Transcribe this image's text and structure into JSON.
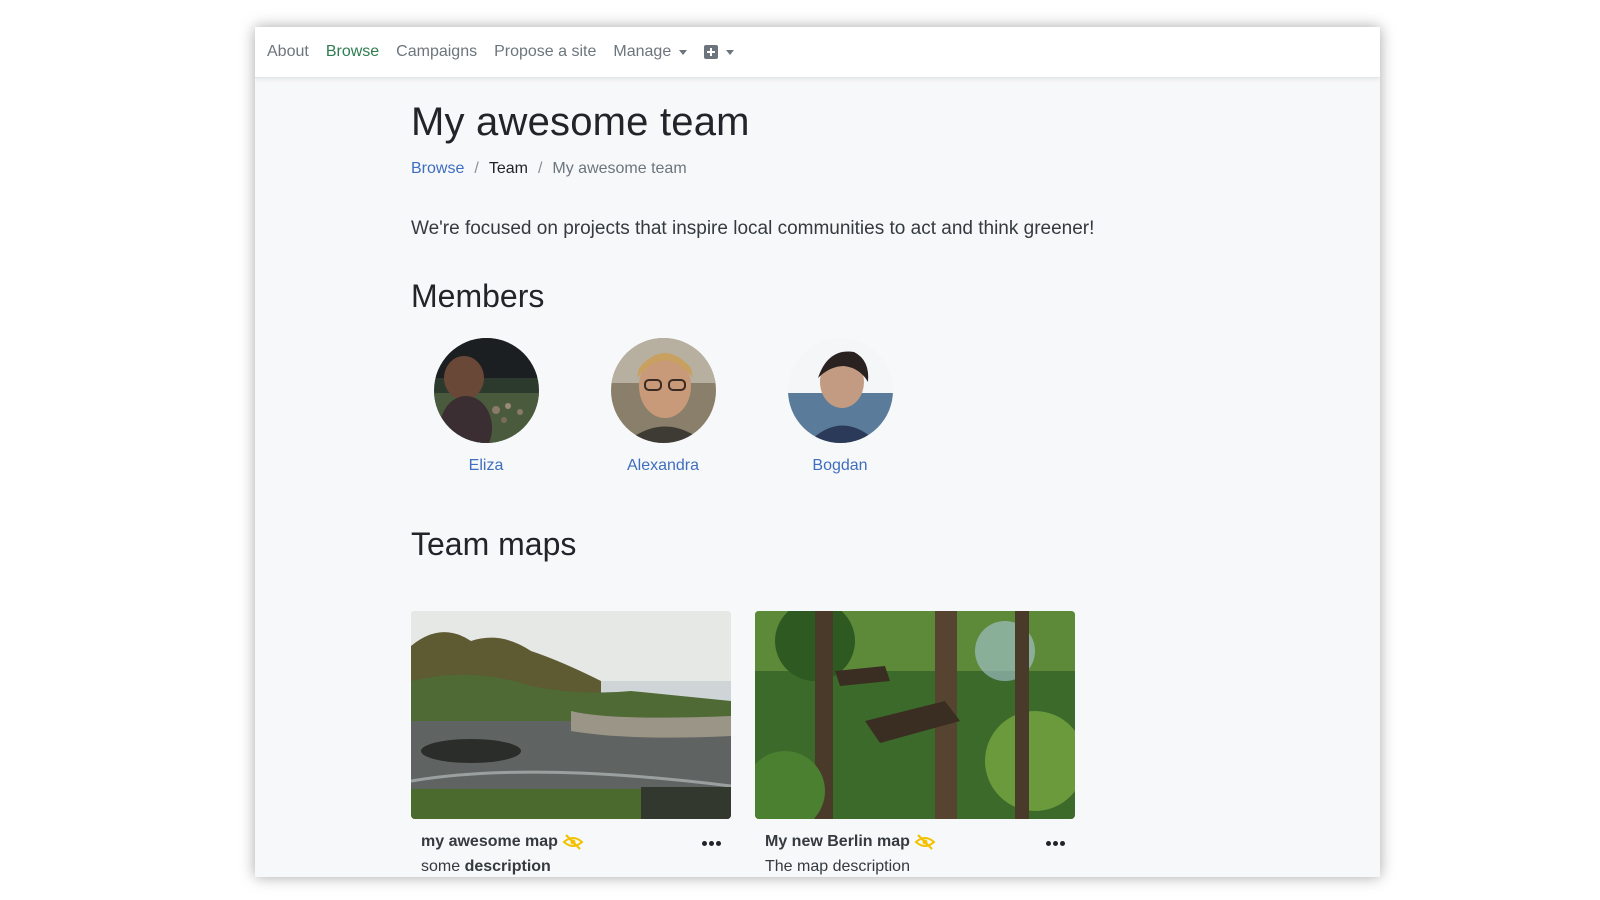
{
  "nav": {
    "items": [
      {
        "label": "About"
      },
      {
        "label": "Browse",
        "active": true
      },
      {
        "label": "Campaigns"
      },
      {
        "label": "Propose a site"
      }
    ],
    "manage_label": "Manage",
    "add_icon": "plus-square-icon"
  },
  "page": {
    "title": "My awesome team",
    "breadcrumb": {
      "browse": "Browse",
      "team": "Team",
      "current": "My awesome team",
      "separator": "/"
    },
    "description": "We're focused on projects that inspire local communities to act and think greener!"
  },
  "members": {
    "heading": "Members",
    "list": [
      {
        "name": "Eliza"
      },
      {
        "name": "Alexandra"
      },
      {
        "name": "Bogdan"
      }
    ]
  },
  "maps": {
    "heading": "Team maps",
    "cards": [
      {
        "title": "my awesome map",
        "description_plain": "some ",
        "description_bold": "description",
        "hidden_icon": "eye-slash-icon"
      },
      {
        "title": "My new Berlin map",
        "description_plain": "The map description",
        "description_bold": "",
        "hidden_icon": "eye-slash-icon"
      }
    ]
  },
  "colors": {
    "link": "#3f6ec0",
    "nav_active": "#2e7d4f",
    "hidden_icon": "#f2c200"
  }
}
